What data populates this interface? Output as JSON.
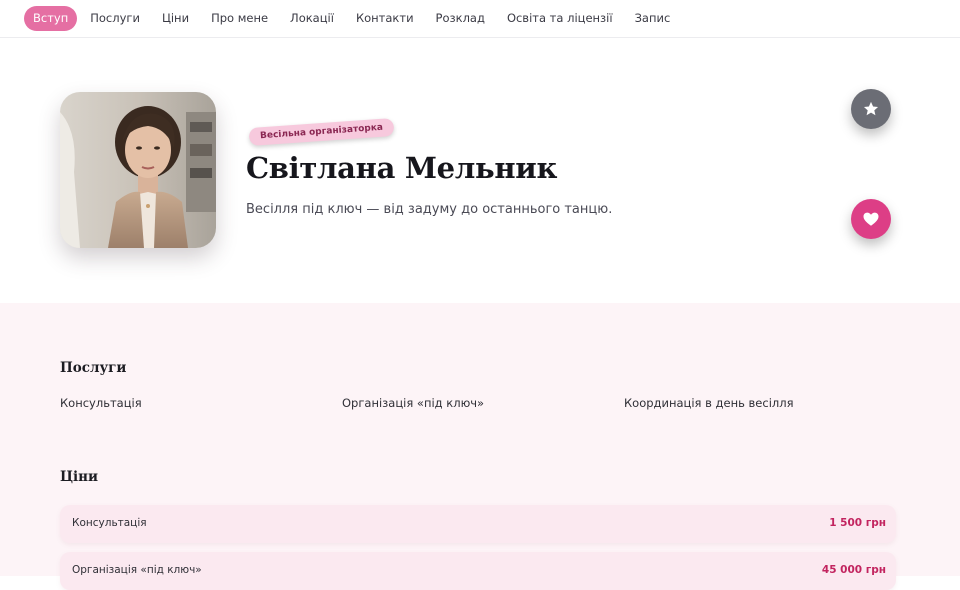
{
  "nav": {
    "items": [
      {
        "label": "Вступ",
        "active": true
      },
      {
        "label": "Послуги",
        "active": false
      },
      {
        "label": "Ціни",
        "active": false
      },
      {
        "label": "Про мене",
        "active": false
      },
      {
        "label": "Локації",
        "active": false
      },
      {
        "label": "Контакти",
        "active": false
      },
      {
        "label": "Розклад",
        "active": false
      },
      {
        "label": "Освіта та ліцензії",
        "active": false
      },
      {
        "label": "Запис",
        "active": false
      }
    ],
    "active_color": "#e56fa3"
  },
  "hero": {
    "tag": "Весільна організаторка",
    "name": "Світлана Мельник",
    "tagline": "Весілля під ключ — від задуму до останнього танцю.",
    "star_icon": "star-icon",
    "heart_icon": "heart-icon"
  },
  "services": {
    "title": "Послуги",
    "items": [
      "Консультація",
      "Організація «під ключ»",
      "Координація в день весілля"
    ]
  },
  "prices": {
    "title": "Ціни",
    "items": [
      {
        "name": "Консультація",
        "price": "1 500 грн"
      },
      {
        "name": "Організація «під ключ»",
        "price": "45 000 грн"
      }
    ]
  },
  "colors": {
    "accent": "#e56fa3",
    "heart": "#dd3e86",
    "price": "#c2245f",
    "content_bg": "#fdf4f7"
  }
}
